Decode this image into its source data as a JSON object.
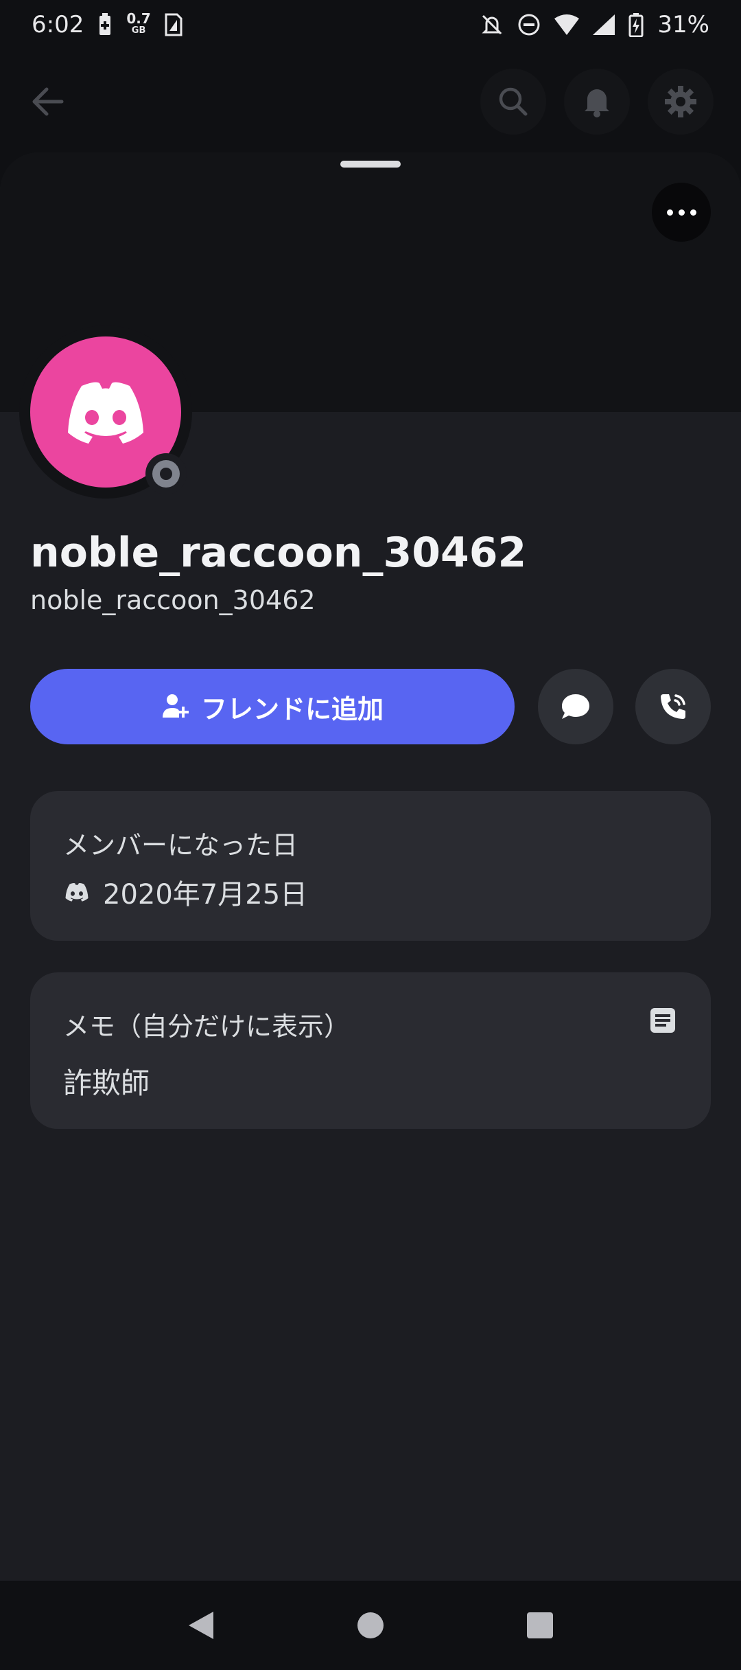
{
  "status_bar": {
    "time": "6:02",
    "data_usage_value": "0.7",
    "data_usage_unit": "GB",
    "battery": "31%"
  },
  "profile": {
    "display_name": "noble_raccoon_30462",
    "username": "noble_raccoon_30462",
    "avatar_color": "#eb459f",
    "status": "offline"
  },
  "actions": {
    "add_friend_label": "フレンドに追加"
  },
  "member_since": {
    "title": "メンバーになった日",
    "date": "2020年7月25日"
  },
  "note": {
    "title": "メモ（自分だけに表示）",
    "value": "詐欺師"
  },
  "colors": {
    "accent": "#5865f2",
    "background": "#1c1d22",
    "card": "#2a2b31"
  }
}
